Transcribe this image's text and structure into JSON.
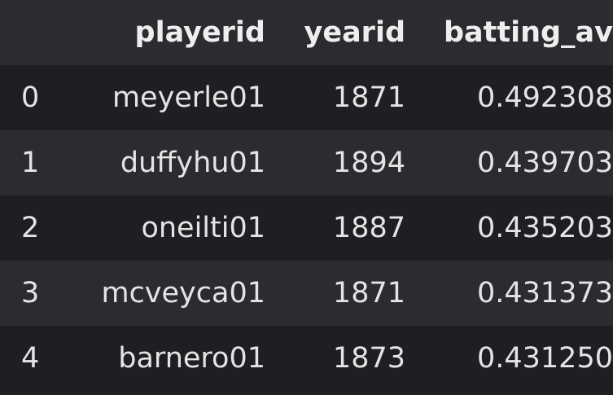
{
  "table": {
    "columns": [
      "",
      "playerid",
      "yearid",
      "batting_av"
    ],
    "rows": [
      {
        "index": "0",
        "playerid": "meyerle01",
        "yearid": "1871",
        "batting_av": "0.492308"
      },
      {
        "index": "1",
        "playerid": "duffyhu01",
        "yearid": "1894",
        "batting_av": "0.439703"
      },
      {
        "index": "2",
        "playerid": "oneilti01",
        "yearid": "1887",
        "batting_av": "0.435203"
      },
      {
        "index": "3",
        "playerid": "mcveyca01",
        "yearid": "1871",
        "batting_av": "0.431373"
      },
      {
        "index": "4",
        "playerid": "barnero01",
        "yearid": "1873",
        "batting_av": "0.431250"
      }
    ]
  },
  "colors": {
    "background": "#1e1f22",
    "stripe": "#2b2c30",
    "text": "#e4e4e4"
  }
}
